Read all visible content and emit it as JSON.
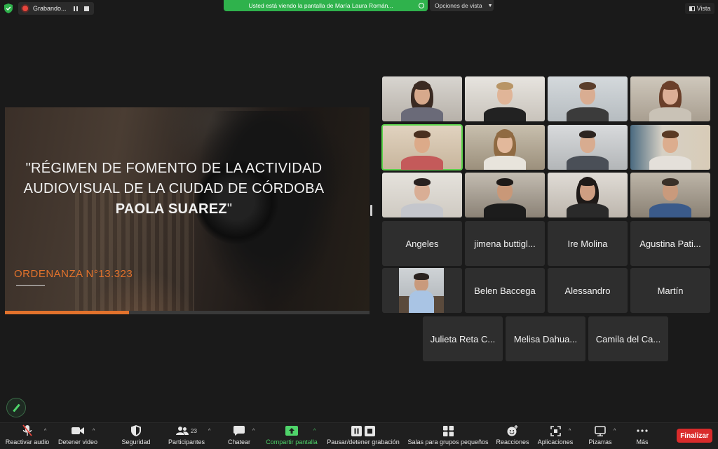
{
  "topbar": {
    "recording_label": "Grabando...",
    "share_banner": "Usted está viendo la pantalla de María Laura Román...",
    "view_options": "Opciones de vista",
    "view_button": "Vista"
  },
  "slide": {
    "title_line1": "\"RÉGIMEN DE FOMENTO DE LA ACTIVIDAD",
    "title_line2": "AUDIOVISUAL DE LA CIUDAD DE CÓRDOBA",
    "title_name": "PAOLA SUAREZ",
    "title_end": "\"",
    "ordinance": "ORDENANZA  N°13.323",
    "progress": 0.34
  },
  "participants": [
    {
      "name": "Angeles"
    },
    {
      "name": "jimena buttigl..."
    },
    {
      "name": "Ire Molina"
    },
    {
      "name": "Agustina Pati..."
    },
    {
      "name": "Belen Baccega"
    },
    {
      "name": "Alessandro"
    },
    {
      "name": "Martín"
    },
    {
      "name": "Julieta Reta C..."
    },
    {
      "name": "Melisa Dahua..."
    },
    {
      "name": "Camila del Ca..."
    }
  ],
  "toolbar": {
    "mute": "Reactivar audio",
    "video": "Detener video",
    "security": "Seguridad",
    "participants": "Participantes",
    "participants_count": "23",
    "chat": "Chatear",
    "share": "Compartir pantalla",
    "recording": "Pausar/detener grabación",
    "breakout": "Salas para grupos pequeños",
    "reactions": "Reacciones",
    "apps": "Aplicaciones",
    "whiteboards": "Pizarras",
    "more": "Más",
    "end": "Finalizar"
  },
  "colors": {
    "accent_green": "#4fd36a",
    "end_red": "#d92b2b",
    "slide_orange": "#e2722c",
    "banner_green": "#2fb24c"
  }
}
